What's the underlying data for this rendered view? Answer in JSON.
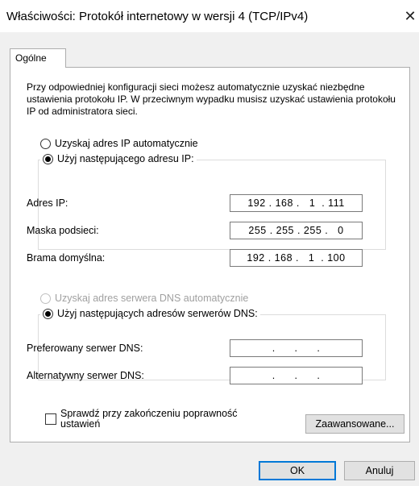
{
  "window": {
    "title": "Właściwości: Protokół internetowy w wersji 4 (TCP/IPv4)",
    "close_glyph": "✕"
  },
  "tabs": [
    {
      "label": "Ogólne"
    }
  ],
  "description": "Przy odpowiedniej konfiguracji sieci możesz automatycznie uzyskać niezbędne ustawienia protokołu IP. W przeciwnym wypadku musisz uzyskać ustawienia protokołu IP od administratora sieci.",
  "ip": {
    "auto_label": "Uzyskaj adres IP automatycznie",
    "manual_label": "Użyj następującego adresu IP:",
    "auto_selected": false,
    "fields": {
      "address": {
        "label": "Adres IP:",
        "value": "192 . 168 .   1  . 111"
      },
      "mask": {
        "label": "Maska podsieci:",
        "value": "255 . 255 . 255 .   0"
      },
      "gateway": {
        "label": "Brama domyślna:",
        "value": "192 . 168 .   1  . 100"
      }
    }
  },
  "dns": {
    "auto_label": "Uzyskaj adres serwera DNS automatycznie",
    "manual_label": "Użyj następujących adresów serwerów DNS:",
    "fields": {
      "preferred": {
        "label": "Preferowany serwer DNS:",
        "value": ".      .      ."
      },
      "alternate": {
        "label": "Alternatywny serwer DNS:",
        "value": ".      .      ."
      }
    }
  },
  "validate": {
    "label": "Sprawdź przy zakończeniu poprawność ustawień",
    "checked": false
  },
  "buttons": {
    "advanced": "Zaawansowane...",
    "ok": "OK",
    "cancel": "Anuluj"
  }
}
